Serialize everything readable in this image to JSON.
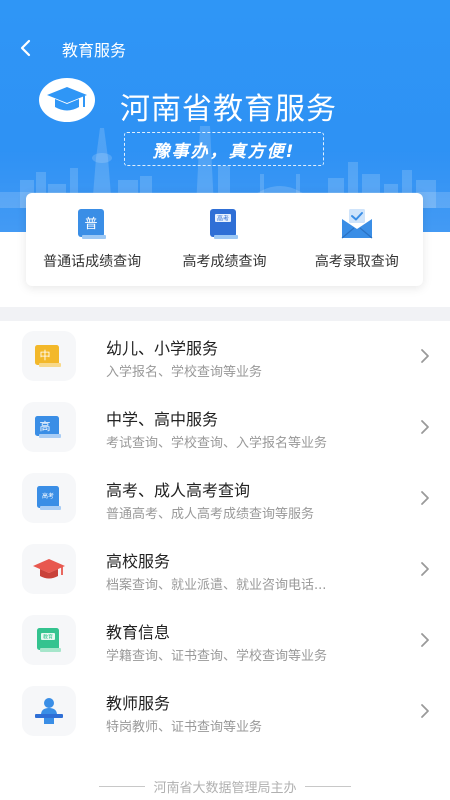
{
  "nav": {
    "title": "教育服务"
  },
  "banner": {
    "title": "河南省教育服务",
    "slogan": "豫事办，真方便!"
  },
  "quick_links": [
    {
      "label": "普通话成绩查询",
      "icon": "putonghua-book-icon",
      "icon_text": "普"
    },
    {
      "label": "高考成绩查询",
      "icon": "gaokao-book-icon",
      "icon_text": "高考"
    },
    {
      "label": "高考录取查询",
      "icon": "admission-envelope-icon"
    }
  ],
  "services": [
    {
      "title": "幼儿、小学服务",
      "subtitle": "入学报名、学校查询等业务",
      "icon": "primary-school-book-icon",
      "icon_text": "中"
    },
    {
      "title": "中学、高中服务",
      "subtitle": "考试查询、学校查询、入学报名等业务",
      "icon": "high-school-book-icon",
      "icon_text": "高"
    },
    {
      "title": "高考、成人高考查询",
      "subtitle": "普通高考、成人高考成绩查询等服务",
      "icon": "exam-book-icon",
      "icon_text": "高考"
    },
    {
      "title": "高校服务",
      "subtitle": "档案查询、就业派遣、就业咨询电话...",
      "icon": "graduation-cap-icon"
    },
    {
      "title": "教育信息",
      "subtitle": "学籍查询、证书查询、学校查询等业务",
      "icon": "education-info-icon",
      "icon_text": "教育"
    },
    {
      "title": "教师服务",
      "subtitle": "特岗教师、证书查询等业务",
      "icon": "teacher-podium-icon"
    }
  ],
  "footer": {
    "text": "河南省大数据管理局主办"
  },
  "colors": {
    "header_blue": "#2f96f6",
    "icon_blue": "#3a8ee6",
    "icon_yellow": "#f3b82a",
    "icon_red": "#e8584f",
    "icon_green": "#34c38f"
  }
}
